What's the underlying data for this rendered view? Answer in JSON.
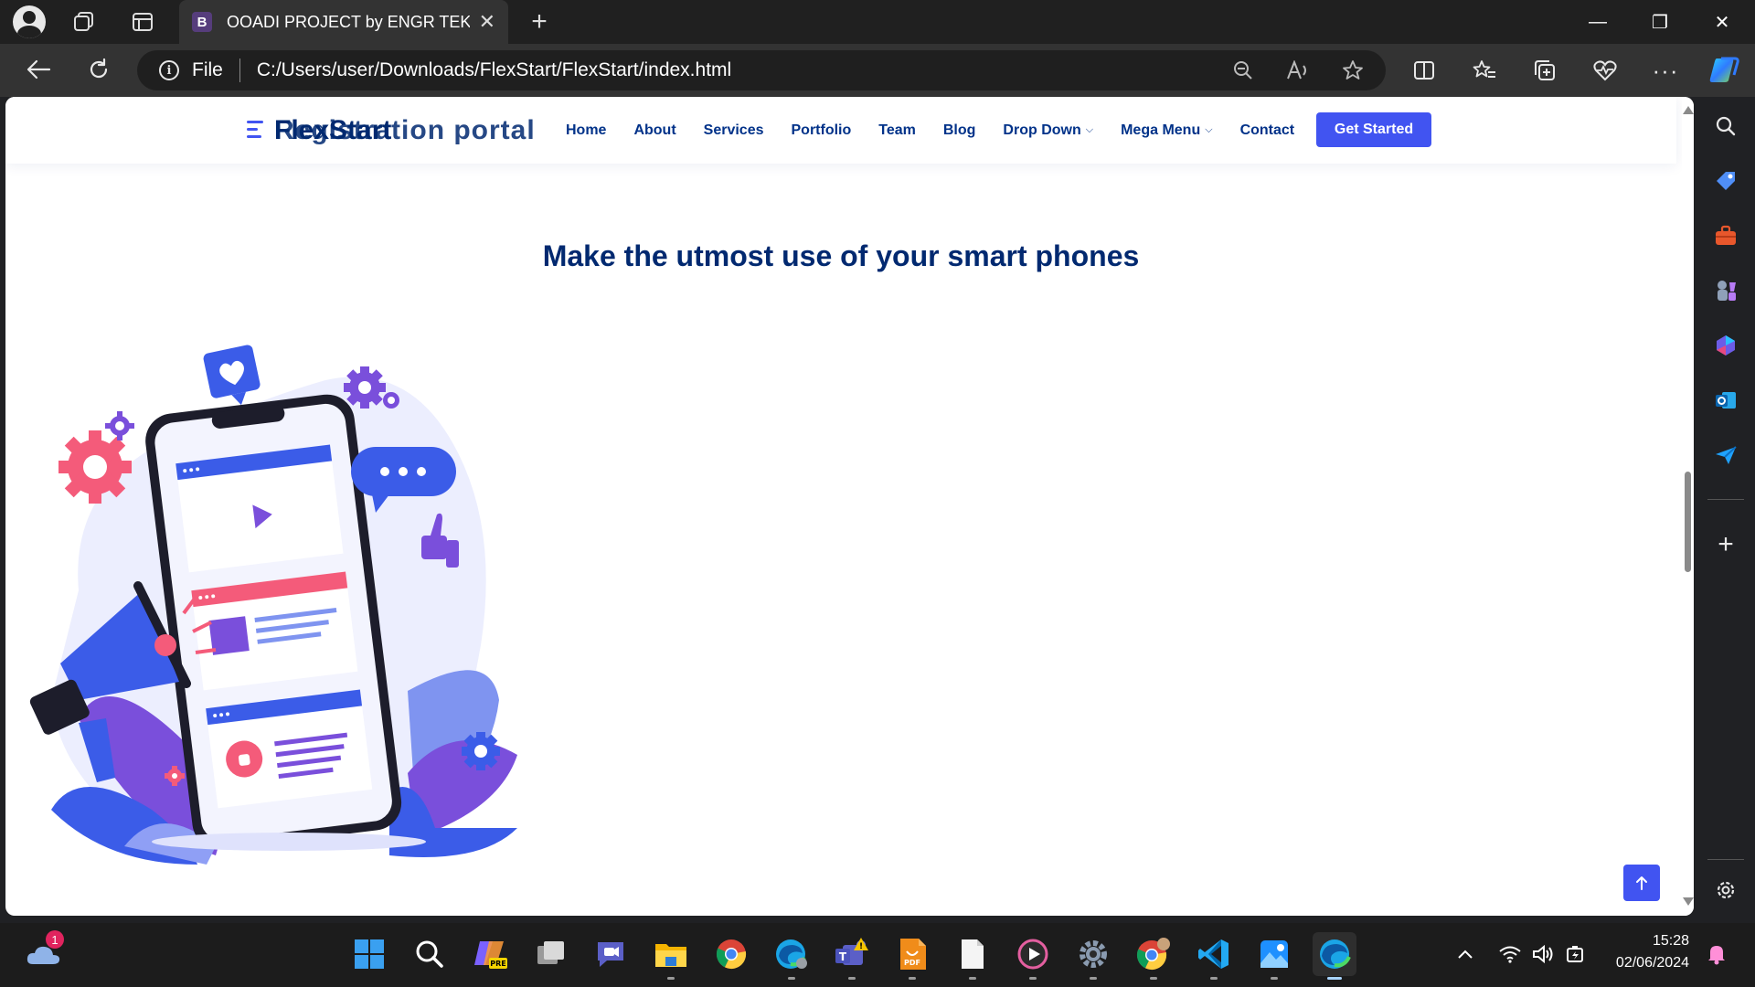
{
  "browser": {
    "tab": {
      "favicon_letter": "B",
      "title": "OOADI PROJECT by ENGR TEKO",
      "close_glyph": "✕"
    },
    "new_tab_glyph": "+",
    "address": {
      "scheme_label": "File",
      "url": "C:/Users/user/Downloads/FlexStart/FlexStart/index.html"
    },
    "window_controls": {
      "minimize": "—",
      "restore": "❐",
      "close": "✕"
    }
  },
  "site": {
    "logo_text_overlap_1": "FlexStart",
    "logo_text_overlap_2": "Registration portal",
    "nav": [
      "Home",
      "About",
      "Services",
      "Portfolio",
      "Team",
      "Blog",
      "Drop Down",
      "Mega Menu",
      "Contact"
    ],
    "cta": "Get Started",
    "hero_heading": "Make the utmost use of your smart phones",
    "back_to_top_glyph": "↑"
  },
  "colors": {
    "brand_primary": "#4154f1",
    "brand_dark": "#012970",
    "illustration_pink": "#f45b7a",
    "illustration_purple": "#7a4fdb",
    "illustration_blue": "#3b5ce8"
  },
  "taskbar": {
    "notification_count": "1",
    "time": "15:28",
    "date": "02/06/2024"
  }
}
